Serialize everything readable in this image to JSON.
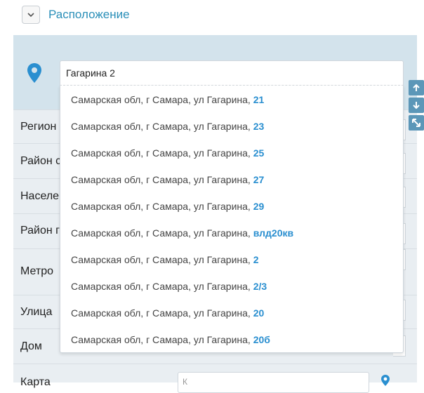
{
  "section": {
    "title": "Расположение",
    "collapse_icon": "chevron-down-icon"
  },
  "address": {
    "value": "Гагарина 2",
    "icon": "map-pin-icon"
  },
  "labels": {
    "region": "Регион",
    "district": "Район с",
    "settlement": "Населе",
    "city_district": "Район г",
    "metro": "Метро",
    "street": "Улица",
    "house": "Дом",
    "map": "Карта"
  },
  "suggestions": [
    {
      "prefix": "Самарская обл, г Самара, ул Гагарина, ",
      "match": "21"
    },
    {
      "prefix": "Самарская обл, г Самара, ул Гагарина, ",
      "match": "23"
    },
    {
      "prefix": "Самарская обл, г Самара, ул Гагарина, ",
      "match": "25"
    },
    {
      "prefix": "Самарская обл, г Самара, ул Гагарина, ",
      "match": "27"
    },
    {
      "prefix": "Самарская обл, г Самара, ул Гагарина, ",
      "match": "29"
    },
    {
      "prefix": "Самарская обл, г Самара, ул Гагарина, ",
      "match": "влд20кв"
    },
    {
      "prefix": "Самарская обл, г Самара, ул Гагарина, ",
      "match": "2"
    },
    {
      "prefix": "Самарская обл, г Самара, ул Гагарина, ",
      "match": "2/3"
    },
    {
      "prefix": "Самарская обл, г Самара, ул Гагарина, ",
      "match": "20"
    },
    {
      "prefix": "Самарская обл, г Самара, ул Гагарина, ",
      "match": "20б"
    }
  ],
  "side_controls": [
    "arrow-up-icon",
    "arrow-down-icon",
    "expand-icon"
  ],
  "map_input_placeholder": "К",
  "colors": {
    "accent": "#2a8fb8",
    "highlight": "#2a8fd0",
    "panel": "#e9eef2",
    "address_band": "#d3e3ec",
    "side_button": "#5c97b8"
  }
}
